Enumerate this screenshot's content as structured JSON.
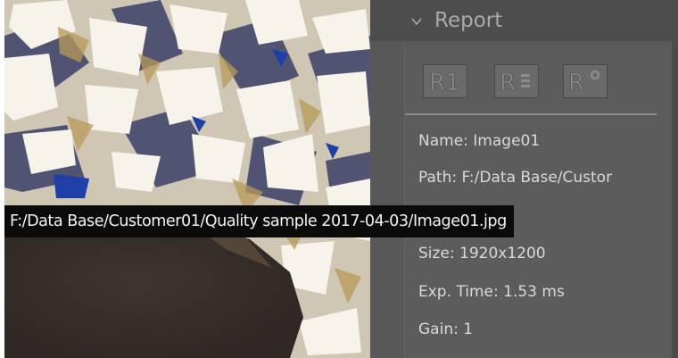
{
  "report_panel": {
    "title": "Report",
    "icons": {
      "collapse": "chevron-down-icon",
      "report_buttons": [
        "r1-report-icon",
        "r-settings-report-icon",
        "r-degree-report-icon"
      ]
    },
    "buttons": [
      {
        "label": "R1"
      },
      {
        "label": "R"
      },
      {
        "label": "R°"
      }
    ],
    "info": {
      "name": "Name: Image01",
      "path": "Path: F:/Data Base/Custor",
      "size": "Size: 1920x1200",
      "exp_time": "Exp. Time: 1.53 ms",
      "gain": "Gain: 1"
    }
  },
  "tooltip": {
    "text": "F:/Data Base/Customer01/Quality sample 2017-04-03/Image01.jpg"
  },
  "colors": {
    "panel_bg": "#585858",
    "header_bg": "#4d4d4d",
    "text": "#d9d9d9",
    "tooltip_bg": "#0a0a0a"
  }
}
